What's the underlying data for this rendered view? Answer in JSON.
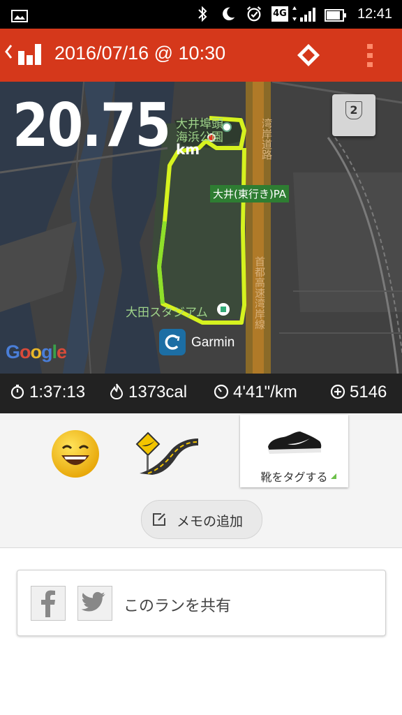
{
  "status_bar": {
    "time": "12:41",
    "network": "4G",
    "icons": [
      "image-icon",
      "bluetooth-icon",
      "moon-icon",
      "alarm-icon",
      "4g-icon",
      "signal-icon",
      "battery-icon"
    ]
  },
  "app_bar": {
    "title": "2016/07/16 @ 10:30",
    "color": "#d5381b"
  },
  "run": {
    "distance": "20.75",
    "distance_unit": "km",
    "lap_badge": "2"
  },
  "map": {
    "labels": {
      "park_line1": "大井埠頭",
      "park_line2": "海浜公園",
      "road_right": "湾岸道路",
      "pa": "大井(東行き)PA",
      "stadium": "大田スタジアム",
      "expressway": "首都高速湾岸線"
    },
    "attribution": "Google",
    "partner": "Garmin",
    "route_color": "#d6f21f"
  },
  "stats": {
    "duration": "1:37:13",
    "calories": "1373cal",
    "pace": "4'41\"/km",
    "fuel": "5146"
  },
  "tags": {
    "shoe_label": "靴をタグする",
    "mood_icon": "smile-face-icon",
    "terrain_icon": "road-icon"
  },
  "memo": {
    "label": "メモの追加"
  },
  "share": {
    "label": "このランを共有"
  }
}
